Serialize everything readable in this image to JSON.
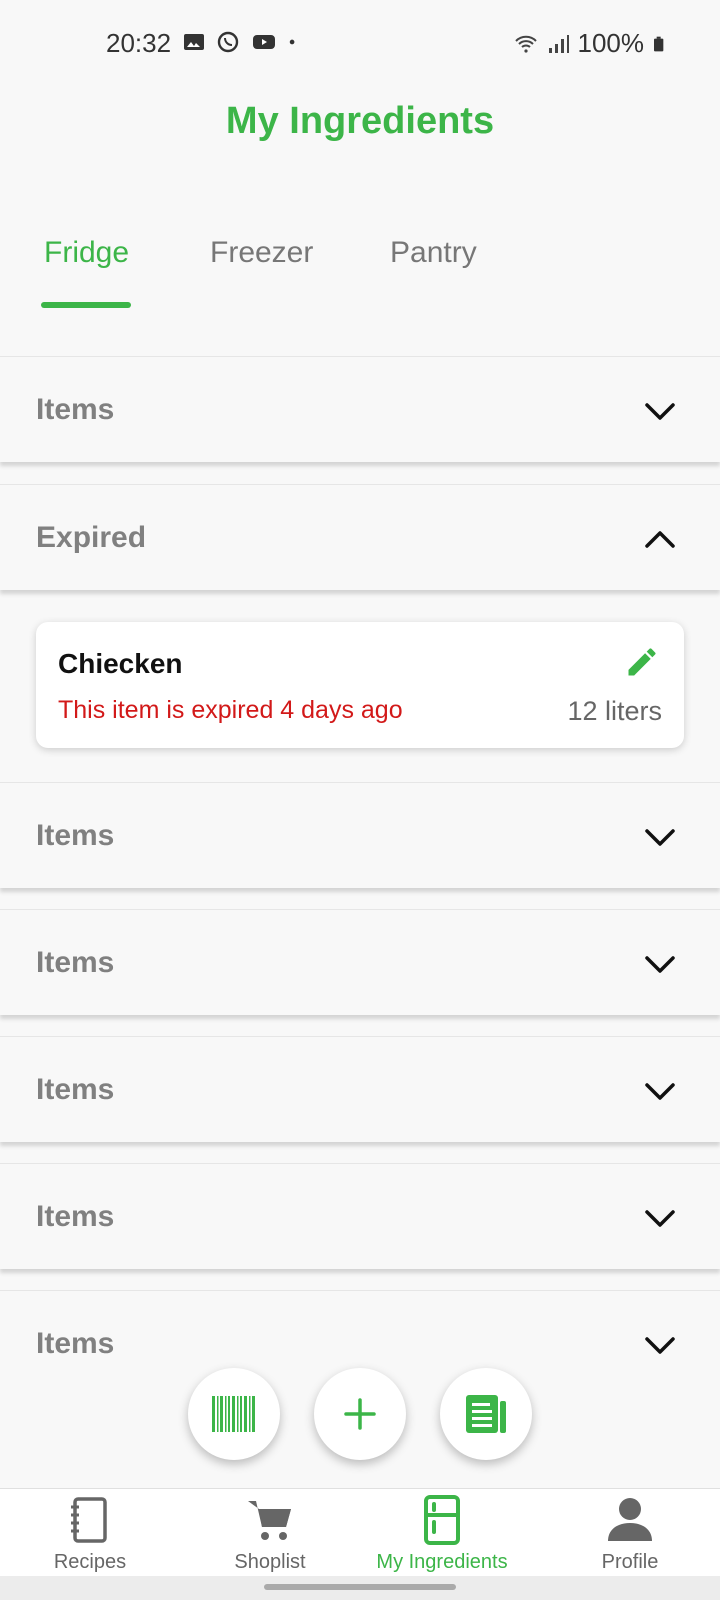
{
  "status_bar": {
    "time": "20:32",
    "battery": "100%"
  },
  "header": {
    "title": "My Ingredients"
  },
  "tabs": [
    {
      "label": "Fridge",
      "active": true
    },
    {
      "label": "Freezer",
      "active": false
    },
    {
      "label": "Pantry",
      "active": false
    }
  ],
  "sections": [
    {
      "label": "Items",
      "expanded": false
    },
    {
      "label": "Expired",
      "expanded": true
    },
    {
      "label": "Items",
      "expanded": false
    },
    {
      "label": "Items",
      "expanded": false
    },
    {
      "label": "Items",
      "expanded": false
    },
    {
      "label": "Items",
      "expanded": false
    },
    {
      "label": "Items",
      "expanded": false
    }
  ],
  "expired_item": {
    "name": "Chiecken",
    "status": "This item is expired 4 days ago",
    "quantity": "12 liters"
  },
  "fabs": [
    "barcode-icon",
    "add-icon",
    "receipt-icon"
  ],
  "bottom_nav": [
    {
      "label": "Recipes",
      "icon": "notebook-icon",
      "active": false
    },
    {
      "label": "Shoplist",
      "icon": "cart-icon",
      "active": false
    },
    {
      "label": "My Ingredients",
      "icon": "fridge-icon",
      "active": true
    },
    {
      "label": "Profile",
      "icon": "person-icon",
      "active": false
    }
  ],
  "colors": {
    "accent": "#3cb548",
    "expired": "#d21919"
  }
}
